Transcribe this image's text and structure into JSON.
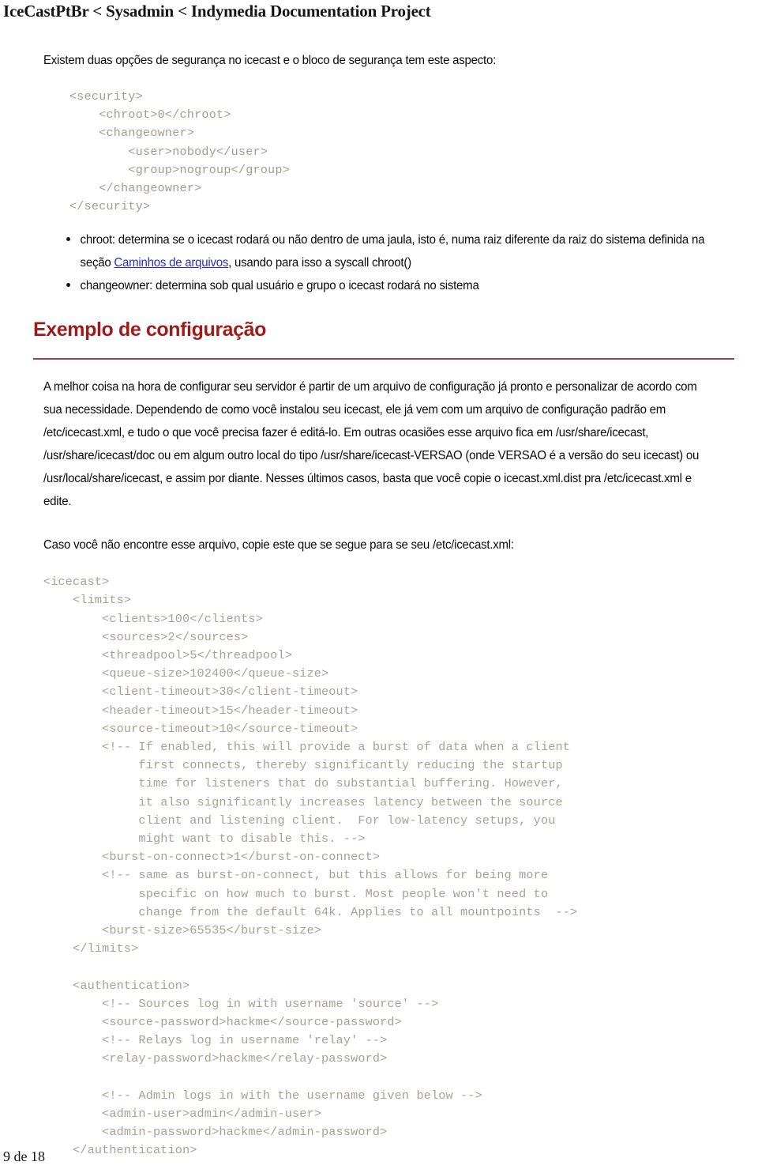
{
  "header": {
    "breadcrumb": "IceCastPtBr < Sysadmin < Indymedia Documentation Project"
  },
  "intro": {
    "paragraph": "Existem duas opções de segurança no icecast e o bloco de segurança tem este aspecto:"
  },
  "security_code": "<security>\n    <chroot>0</chroot>\n    <changeowner>\n        <user>nobody</user>\n        <group>nogroup</group>\n    </changeowner>\n</security>",
  "bullets": {
    "chroot_part1": "chroot: determina se o icecast rodará ou não dentro de uma jaula, isto é, numa raiz diferente da raiz do sistema definida na seção ",
    "chroot_link": "Caminhos de arquivos",
    "chroot_part2": ", usando para isso a syscall chroot()",
    "changeowner": "changeowner: determina sob qual usuário e grupo o icecast rodará no sistema"
  },
  "section": {
    "heading": "Exemplo de configuração",
    "paragraph1": "A melhor coisa na hora de configurar seu servidor é partir de um arquivo de configuração já pronto e personalizar de acordo com sua necessidade. Dependendo de como você instalou seu icecast, ele já vem com um arquivo de configuração padrão em /etc/icecast.xml, e tudo o que você precisa fazer é editá-lo. Em outras ocasiões esse arquivo fica em /usr/share/icecast, /usr/share/icecast/doc ou em algum outro local do tipo /usr/share/icecast-VERSAO (onde VERSAO é a versão do seu icecast) ou /usr/local/share/icecast, e assim por diante. Nesses últimos casos, basta que você copie o icecast.xml.dist pra /etc/icecast.xml e edite.",
    "paragraph2": "Caso você não encontre esse arquivo, copie este que se segue para se seu /etc/icecast.xml:"
  },
  "icecast_config_code": "<icecast>\n    <limits>\n        <clients>100</clients>\n        <sources>2</sources>\n        <threadpool>5</threadpool>\n        <queue-size>102400</queue-size>\n        <client-timeout>30</client-timeout>\n        <header-timeout>15</header-timeout>\n        <source-timeout>10</source-timeout>\n        <!-- If enabled, this will provide a burst of data when a client\n             first connects, thereby significantly reducing the startup\n             time for listeners that do substantial buffering. However,\n             it also significantly increases latency between the source\n             client and listening client.  For low-latency setups, you\n             might want to disable this. -->\n        <burst-on-connect>1</burst-on-connect>\n        <!-- same as burst-on-connect, but this allows for being more\n             specific on how much to burst. Most people won't need to\n             change from the default 64k. Applies to all mountpoints  -->\n        <burst-size>65535</burst-size>\n    </limits>\n\n    <authentication>\n        <!-- Sources log in with username 'source' -->\n        <source-password>hackme</source-password>\n        <!-- Relays log in username 'relay' -->\n        <relay-password>hackme</relay-password>\n\n        <!-- Admin logs in with the username given below -->\n        <admin-user>admin</admin-user>\n        <admin-password>hackme</admin-password>\n    </authentication>",
  "footer": {
    "page_number": "9 de 18"
  },
  "colors": {
    "heading": "#9e1b1b",
    "link": "#2b2bc0",
    "code": "#a39a90",
    "text": "#0b0b0b"
  }
}
